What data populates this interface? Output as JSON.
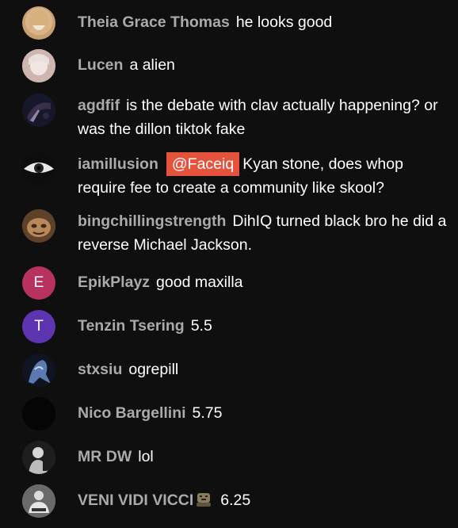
{
  "chat": {
    "messages": [
      {
        "author": "Theia Grace Thomas",
        "text": "he looks good",
        "avatar": "photo-avatar"
      },
      {
        "author": "Lucen",
        "text": "a alien",
        "avatar": "photo-avatar"
      },
      {
        "author": "agdfif",
        "text": "is the debate with clav actually happening? or was the dillon tiktok fake",
        "avatar": "photo-avatar"
      },
      {
        "author": "iamillusion",
        "mention": "@Faceiq",
        "text": "Kyan stone, does whop require fee to create a community like skool?",
        "avatar": "photo-avatar"
      },
      {
        "author": "bingchillingstrength",
        "text": "DihIQ turned black bro he did a reverse Michael Jackson.",
        "avatar": "photo-avatar"
      },
      {
        "author": "EpikPlayz",
        "text": "good maxilla",
        "avatar": "E",
        "avatar_color": "#b8325f"
      },
      {
        "author": "Tenzin Tsering",
        "text": "5.5",
        "avatar": "T",
        "avatar_color": "#5e35b1"
      },
      {
        "author": "stxsiu",
        "text": "ogrepill",
        "avatar": "photo-avatar"
      },
      {
        "author": "Nico Bargellini",
        "text": "5.75",
        "avatar": "photo-avatar"
      },
      {
        "author": "MR DW",
        "text": "lol",
        "avatar": "photo-avatar"
      },
      {
        "author": "VENI VIDI VICCI",
        "emoji": "crying-face-emoji",
        "text": "6.25",
        "avatar": "photo-avatar"
      }
    ]
  }
}
